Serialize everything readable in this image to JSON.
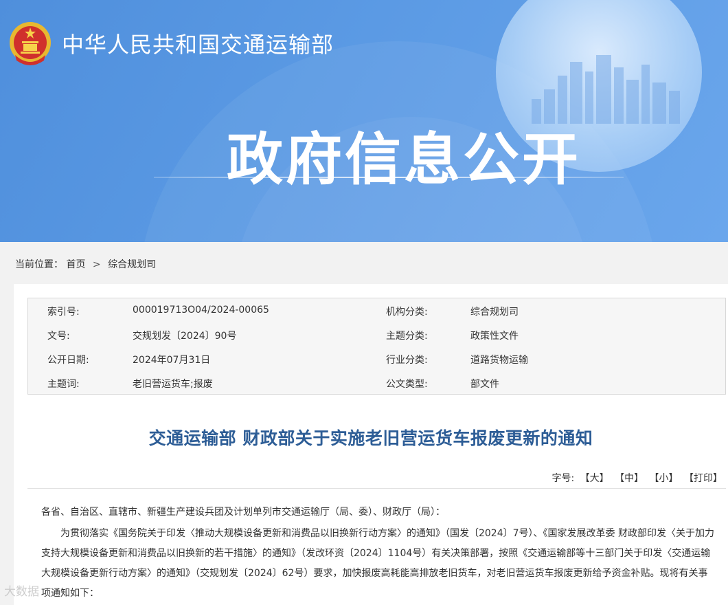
{
  "header": {
    "ministry_name": "中华人民共和国交通运输部",
    "banner_title": "政府信息公开"
  },
  "breadcrumb": {
    "prefix": "当前位置：",
    "items": [
      "首页",
      "综合规划司"
    ],
    "separator": ">"
  },
  "meta": {
    "rows": [
      {
        "label1": "索引号:",
        "value1": "000019713O04/2024-00065",
        "label2": "机构分类:",
        "value2": "综合规划司"
      },
      {
        "label1": "文号:",
        "value1": "交规划发〔2024〕90号",
        "label2": "主题分类:",
        "value2": "政策性文件"
      },
      {
        "label1": "公开日期:",
        "value1": "2024年07月31日",
        "label2": "行业分类:",
        "value2": "道路货物运输"
      },
      {
        "label1": "主题词:",
        "value1": "老旧营运货车;报废",
        "label2": "公文类型:",
        "value2": "部文件"
      }
    ]
  },
  "document": {
    "title": "交通运输部 财政部关于实施老旧营运货车报废更新的通知",
    "font_label": "字号:",
    "font_large": "【大】",
    "font_medium": "【中】",
    "font_small": "【小】",
    "print": "【打印】",
    "salutation": "各省、自治区、直辖市、新疆生产建设兵团及计划单列市交通运输厅（局、委）、财政厅（局）：",
    "paragraph1": "为贯彻落实《国务院关于印发〈推动大规模设备更新和消费品以旧换新行动方案〉的通知》（国发〔2024〕7号）、《国家发展改革委 财政部印发〈关于加力支持大规模设备更新和消费品以旧换新的若干措施〉的通知》（发改环资〔2024〕1104号）有关决策部署，按照《交通运输部等十三部门关于印发〈交通运输大规模设备更新行动方案〉的通知》（交规划发〔2024〕62号）要求，加快报废高耗能高排放老旧货车，对老旧营运货车报废更新给予资金补贴。现将有关事项通知如下："
  },
  "watermark": "大数据"
}
